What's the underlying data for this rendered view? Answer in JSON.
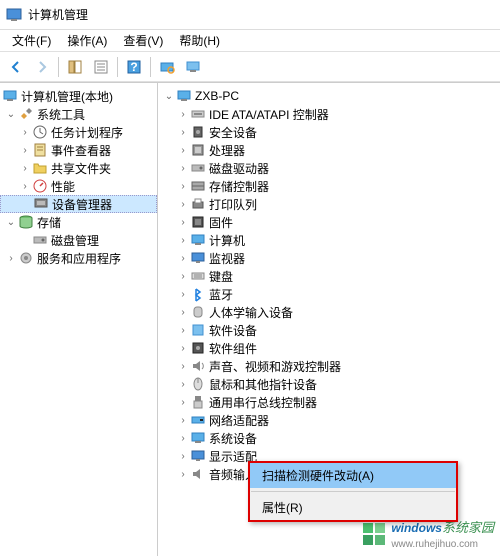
{
  "window": {
    "title": "计算机管理"
  },
  "menu": {
    "file": "文件(F)",
    "action": "操作(A)",
    "view": "查看(V)",
    "help": "帮助(H)"
  },
  "left_tree": {
    "root": "计算机管理(本地)",
    "system_tools": "系统工具",
    "task": "任务计划程序",
    "event": "事件查看器",
    "shared": "共享文件夹",
    "perf": "性能",
    "devmgr": "设备管理器",
    "storage": "存储",
    "disk": "磁盘管理",
    "services": "服务和应用程序"
  },
  "right_tree": {
    "root": "ZXB-PC",
    "items": [
      {
        "k": "ide",
        "label": "IDE ATA/ATAPI 控制器"
      },
      {
        "k": "security",
        "label": "安全设备"
      },
      {
        "k": "cpu",
        "label": "处理器"
      },
      {
        "k": "diskdrive",
        "label": "磁盘驱动器"
      },
      {
        "k": "storagectrl",
        "label": "存储控制器"
      },
      {
        "k": "printqueue",
        "label": "打印队列"
      },
      {
        "k": "firmware",
        "label": "固件"
      },
      {
        "k": "computer",
        "label": "计算机"
      },
      {
        "k": "monitor",
        "label": "监视器"
      },
      {
        "k": "keyboard",
        "label": "键盘"
      },
      {
        "k": "bluetooth",
        "label": "蓝牙"
      },
      {
        "k": "hid",
        "label": "人体学输入设备"
      },
      {
        "k": "software",
        "label": "软件设备"
      },
      {
        "k": "swcomp",
        "label": "软件组件"
      },
      {
        "k": "sound",
        "label": "声音、视频和游戏控制器"
      },
      {
        "k": "mouse",
        "label": "鼠标和其他指针设备"
      },
      {
        "k": "usb",
        "label": "通用串行总线控制器"
      },
      {
        "k": "netadapter",
        "label": "网络适配器"
      },
      {
        "k": "sysdevices",
        "label": "系统设备"
      },
      {
        "k": "display",
        "label": "显示适配器"
      },
      {
        "k": "audio",
        "label": "音频输入和输出"
      }
    ]
  },
  "context_menu": {
    "scan": "扫描检测硬件改动(A)",
    "props": "属性(R)"
  },
  "watermark": {
    "main": "windows",
    "sub": "www.ruhejihuo.com",
    "tag": "系统家园"
  }
}
